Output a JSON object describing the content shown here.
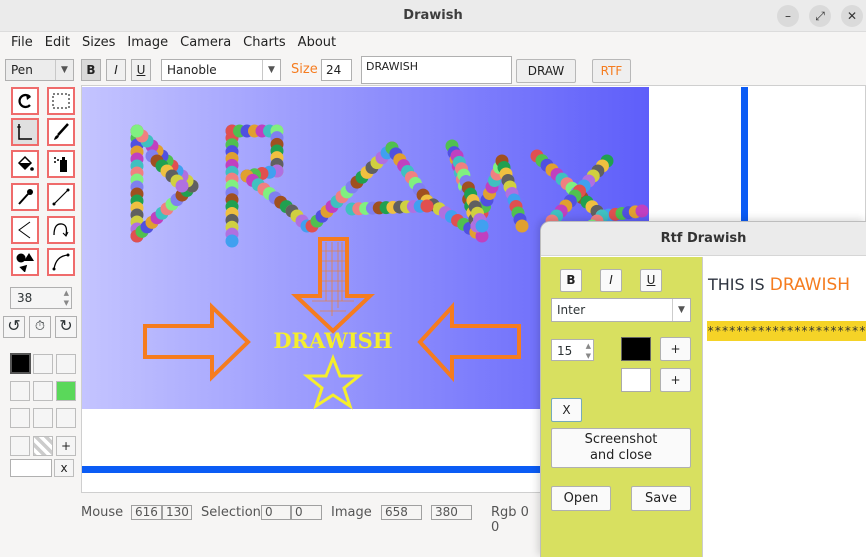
{
  "window": {
    "title": "Drawish"
  },
  "menu": [
    "File",
    "Edit",
    "Sizes",
    "Image",
    "Camera",
    "Charts",
    "About"
  ],
  "toolbar": {
    "tool_select": "Pen",
    "bold": "B",
    "italic": "I",
    "underline": "U",
    "font": "Hanoble",
    "size_label": "Size",
    "size_value": "24",
    "text_value": "DRAWISH",
    "draw_button": "DRAW",
    "rtf_button": "RTF",
    "accent": "#f57c1f"
  },
  "left_panel": {
    "stroke_value": "38",
    "add_label": "+",
    "clear_label": "x"
  },
  "canvas": {
    "banner_text": "DRAWISH",
    "gradient_left": "#c4c4ff",
    "gradient_right": "#5e5efa",
    "arrow_color": "#f57c1f",
    "text_color": "#f5ee2c",
    "blue_line": "#0b5cf5"
  },
  "status": {
    "mouse_label": "Mouse",
    "mouse_x": "616",
    "mouse_y": "130",
    "selection_label": "Selection",
    "sel_x": "0",
    "sel_y": "0",
    "image_label": "Image",
    "img_w": "658",
    "img_h": "380",
    "rgb_label": "Rgb 0 0"
  },
  "rtf": {
    "title": "Rtf Drawish",
    "bold": "B",
    "italic": "I",
    "underline": "U",
    "font": "Inter",
    "size": "15",
    "plus1": "+",
    "plus2": "+",
    "close_x": "X",
    "screenshot_line1": "Screenshot",
    "screenshot_line2": "and close",
    "open": "Open",
    "save": "Save",
    "text_prefix": "THIS IS ",
    "text_highlight": "DRAWISH",
    "stars": "****************************",
    "panel_color": "#d8e060"
  }
}
